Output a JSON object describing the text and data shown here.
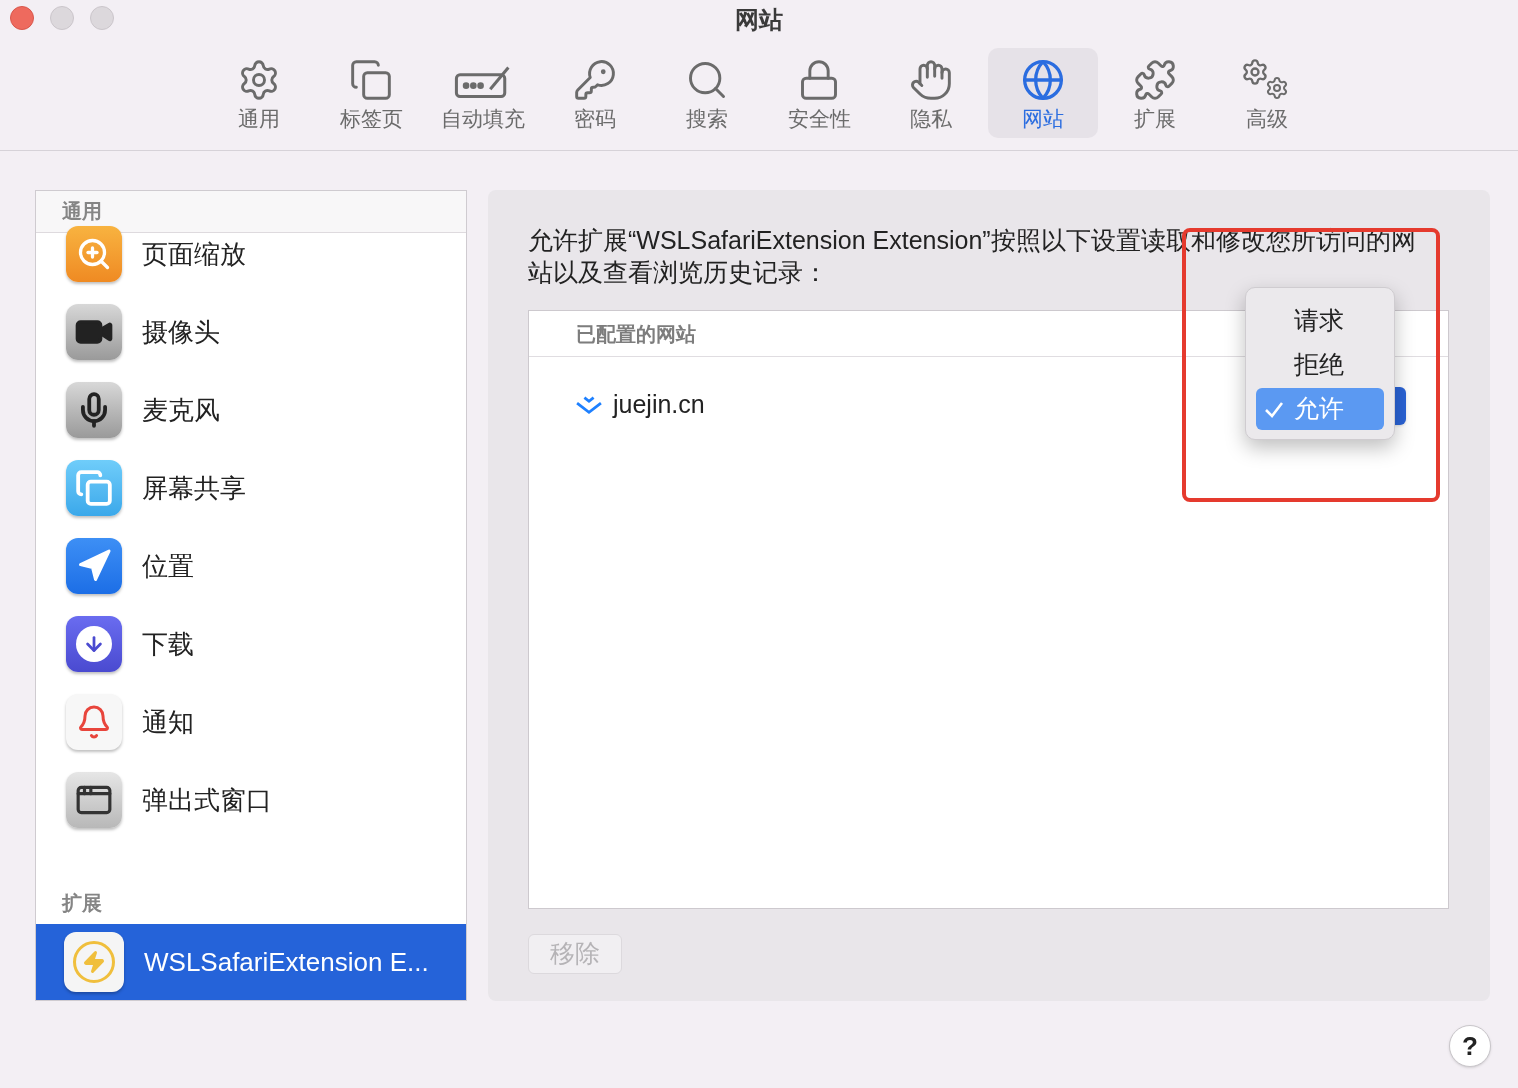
{
  "window": {
    "title": "网站"
  },
  "toolbar": [
    {
      "label": "通用",
      "selected": false
    },
    {
      "label": "标签页",
      "selected": false
    },
    {
      "label": "自动填充",
      "selected": false
    },
    {
      "label": "密码",
      "selected": false
    },
    {
      "label": "搜索",
      "selected": false
    },
    {
      "label": "安全性",
      "selected": false
    },
    {
      "label": "隐私",
      "selected": false
    },
    {
      "label": "网站",
      "selected": true
    },
    {
      "label": "扩展",
      "selected": false
    },
    {
      "label": "高级",
      "selected": false
    }
  ],
  "sidebar": {
    "sections": [
      {
        "title": "通用",
        "items": [
          {
            "label": "页面缩放",
            "selected": false
          },
          {
            "label": "摄像头",
            "selected": false
          },
          {
            "label": "麦克风",
            "selected": false
          },
          {
            "label": "屏幕共享",
            "selected": false
          },
          {
            "label": "位置",
            "selected": false
          },
          {
            "label": "下载",
            "selected": false
          },
          {
            "label": "通知",
            "selected": false
          },
          {
            "label": "弹出式窗口",
            "selected": false
          }
        ]
      },
      {
        "title": "扩展",
        "items": [
          {
            "label": "WSLSafariExtension E...",
            "selected": true
          }
        ]
      }
    ]
  },
  "description": "允许扩展“WSLSafariExtension Extension”按照以下设置读取和修改您所访问的网站以及查看浏览历史记录：",
  "table": {
    "columns": [
      "已配置的网站"
    ],
    "rows": [
      {
        "site": "juejin.cn"
      }
    ]
  },
  "menu": [
    {
      "label": "请求",
      "selected": false
    },
    {
      "label": "拒绝",
      "selected": false
    },
    {
      "label": "允许",
      "selected": true
    }
  ],
  "remove_button": {
    "label": "移除",
    "disabled": true
  },
  "help_button": {
    "label": "?"
  }
}
